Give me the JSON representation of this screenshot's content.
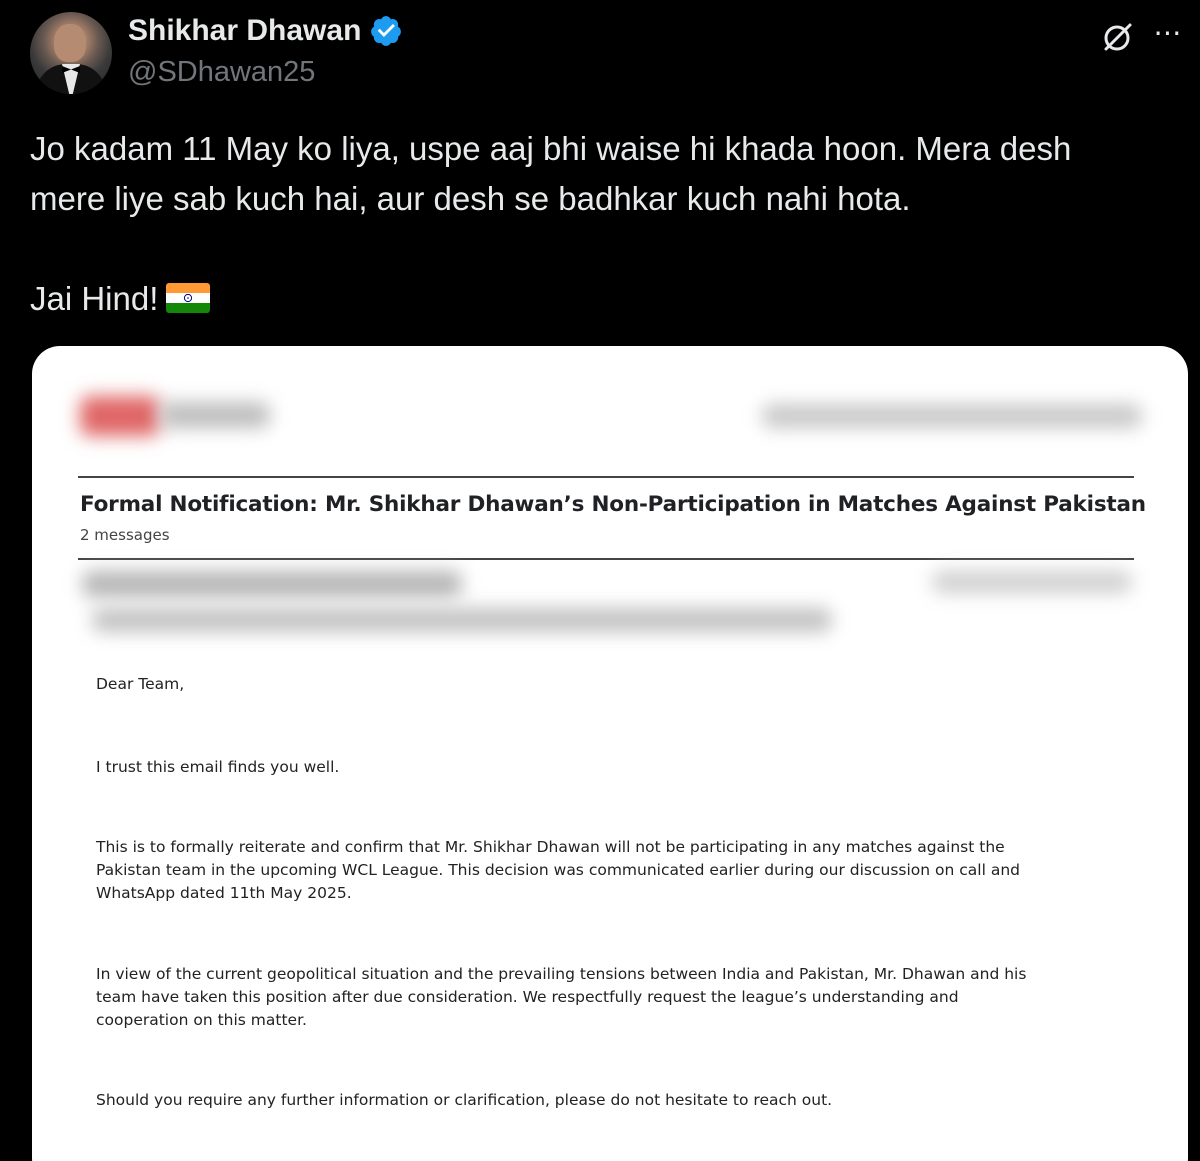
{
  "author": {
    "display_name": "Shikhar Dhawan",
    "handle": "@SDhawan25"
  },
  "tweet": {
    "line_1": "Jo kadam 11 May ko liya, uspe aaj bhi waise hi khada hoon. Mera desh",
    "line_2": "mere liye sab kuch hai, aur desh se badhkar kuch nahi hota.",
    "closing": "Jai Hind!"
  },
  "email": {
    "subject": "Formal Notification: Mr. Shikhar Dhawan’s Non-Participation in Matches Against Pakistan",
    "message_count": "2 messages",
    "greeting": "Dear Team,",
    "para_1": "I trust this email finds you well.",
    "para_2_line_1": "This is to formally reiterate and confirm that Mr. Shikhar Dhawan will not be participating in any matches against the",
    "para_2_line_2": "Pakistan team in the upcoming WCL League. This decision was communicated earlier during our discussion on call and",
    "para_2_line_3": "WhatsApp dated 11th May 2025.",
    "para_3_line_1": "In view of the current geopolitical situation and the prevailing tensions between India and Pakistan, Mr. Dhawan and his",
    "para_3_line_2": "team have taken this position after due consideration. We respectfully request the league’s understanding and",
    "para_3_line_3": "cooperation on this matter.",
    "para_4": "Should you require any further information or clarification, please do not hesitate to reach out."
  },
  "icons": {
    "verified": "verified-badge-icon",
    "grok": "grok-icon",
    "more": "more-options-icon",
    "flag": "india-flag-icon"
  },
  "colors": {
    "background": "#000000",
    "text_primary": "#e7e9ea",
    "text_secondary": "#71767b",
    "verified_blue": "#1d9bf0",
    "card_background": "#ffffff"
  }
}
